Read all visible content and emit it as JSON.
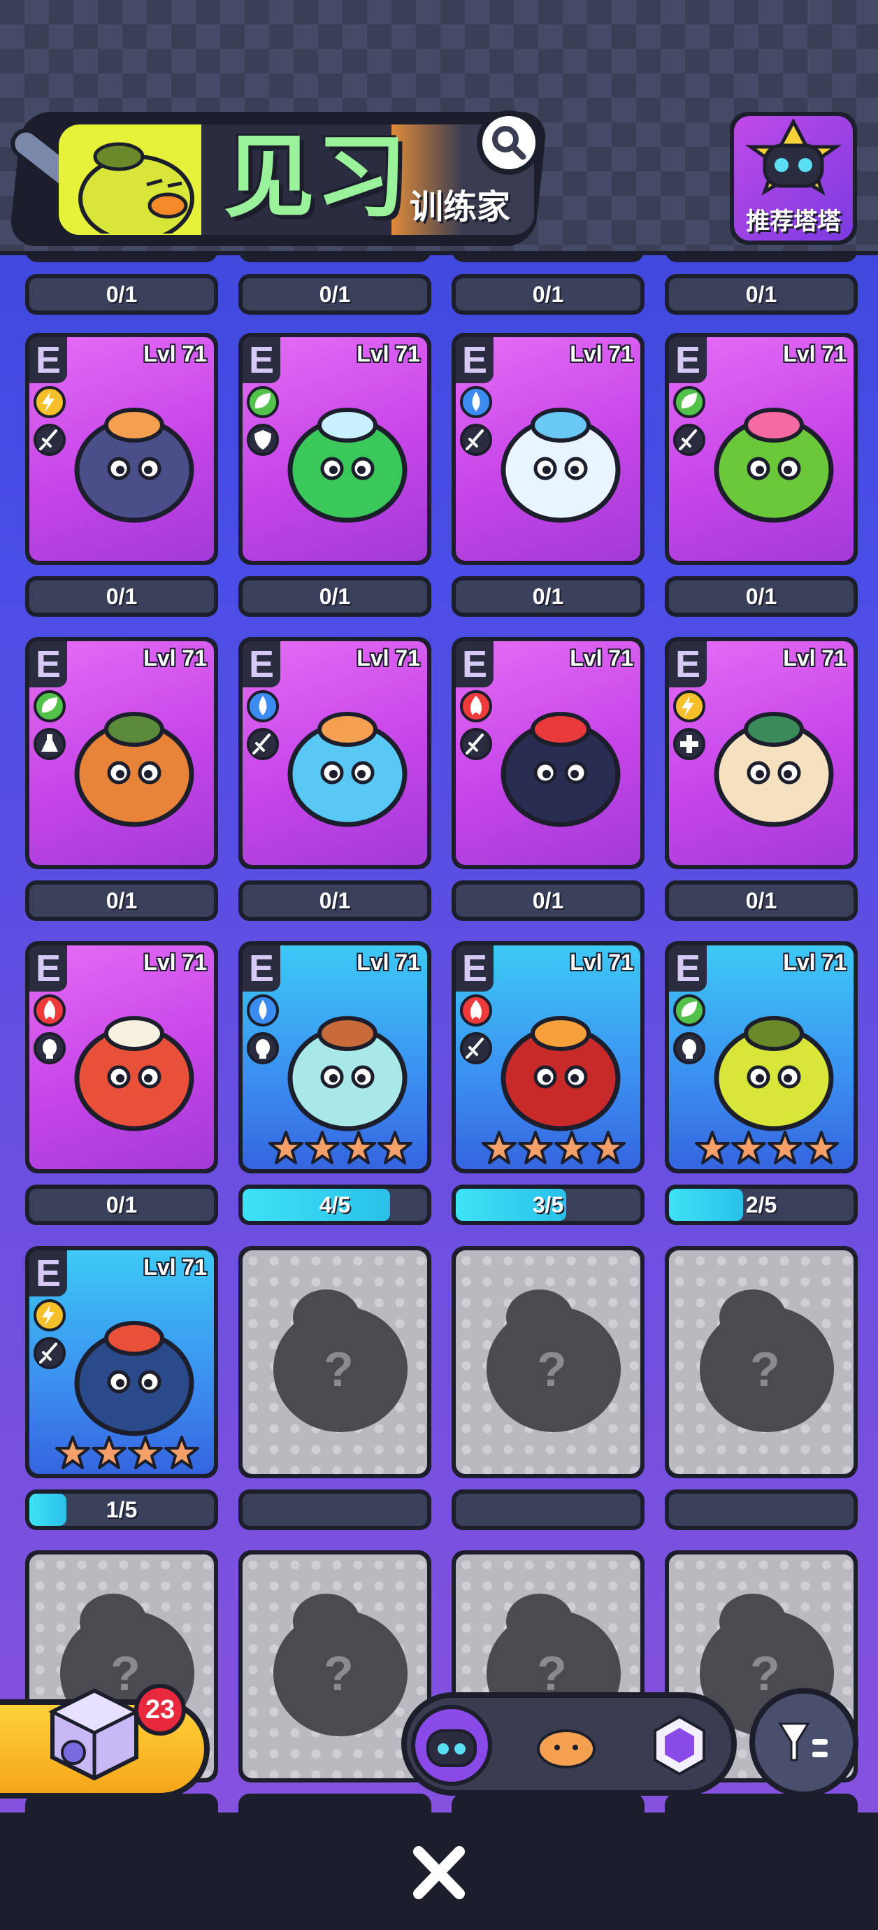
{
  "header": {
    "title": "见习",
    "subtitle": "训练家",
    "recommend_label": "推荐塔塔"
  },
  "top_row_progress": [
    "0/1",
    "0/1",
    "0/1",
    "0/1"
  ],
  "cards": [
    {
      "rank": "E",
      "level": "Lvl 71",
      "element": "lightning",
      "role": "sword",
      "variant": "purple",
      "progress": "0/1",
      "monster": "boar"
    },
    {
      "rank": "E",
      "level": "Lvl 71",
      "element": "leaf",
      "role": "shield",
      "variant": "purple",
      "progress": "0/1",
      "monster": "slime-jar"
    },
    {
      "rank": "E",
      "level": "Lvl 71",
      "element": "water",
      "role": "sword",
      "variant": "purple",
      "progress": "0/1",
      "monster": "jellyfish"
    },
    {
      "rank": "E",
      "level": "Lvl 71",
      "element": "leaf",
      "role": "sword",
      "variant": "purple",
      "progress": "0/1",
      "monster": "cactus"
    },
    {
      "rank": "E",
      "level": "Lvl 71",
      "element": "leaf",
      "role": "potion",
      "variant": "purple",
      "progress": "0/1",
      "monster": "mushroom"
    },
    {
      "rank": "E",
      "level": "Lvl 71",
      "element": "water",
      "role": "sword",
      "variant": "purple",
      "progress": "0/1",
      "monster": "octopus"
    },
    {
      "rank": "E",
      "level": "Lvl 71",
      "element": "fire",
      "role": "sword",
      "variant": "purple",
      "progress": "0/1",
      "monster": "fox"
    },
    {
      "rank": "E",
      "level": "Lvl 71",
      "element": "lightning",
      "role": "heal",
      "variant": "purple",
      "progress": "0/1",
      "monster": "flower-bug"
    },
    {
      "rank": "E",
      "level": "Lvl 71",
      "element": "fire",
      "role": "fist",
      "variant": "purple",
      "progress": "0/1",
      "monster": "fish"
    },
    {
      "rank": "E",
      "level": "Lvl 71",
      "element": "water",
      "role": "fist",
      "variant": "blue",
      "progress": "4/5",
      "fill": 0.8,
      "stars": 4,
      "monster": "shell-crab"
    },
    {
      "rank": "E",
      "level": "Lvl 71",
      "element": "fire",
      "role": "sword",
      "variant": "blue",
      "progress": "3/5",
      "fill": 0.6,
      "stars": 4,
      "monster": "owl"
    },
    {
      "rank": "E",
      "level": "Lvl 71",
      "element": "leaf",
      "role": "fist",
      "variant": "blue",
      "progress": "2/5",
      "fill": 0.4,
      "stars": 4,
      "monster": "pear-duck"
    },
    {
      "rank": "E",
      "level": "Lvl 71",
      "element": "lightning",
      "role": "sword",
      "variant": "blue",
      "progress": "1/5",
      "fill": 0.2,
      "stars": 4,
      "monster": "frog"
    }
  ],
  "locked_mark": "?",
  "dice_count": "23",
  "colors": {
    "lightning": "#f5c02a",
    "leaf": "#52c24a",
    "water": "#3a8cf0",
    "fire": "#ee3a3a",
    "star": "#f5a068"
  },
  "icons": {
    "search": "magnifier-icon",
    "close": "close-icon",
    "filter": "filter-icon"
  }
}
